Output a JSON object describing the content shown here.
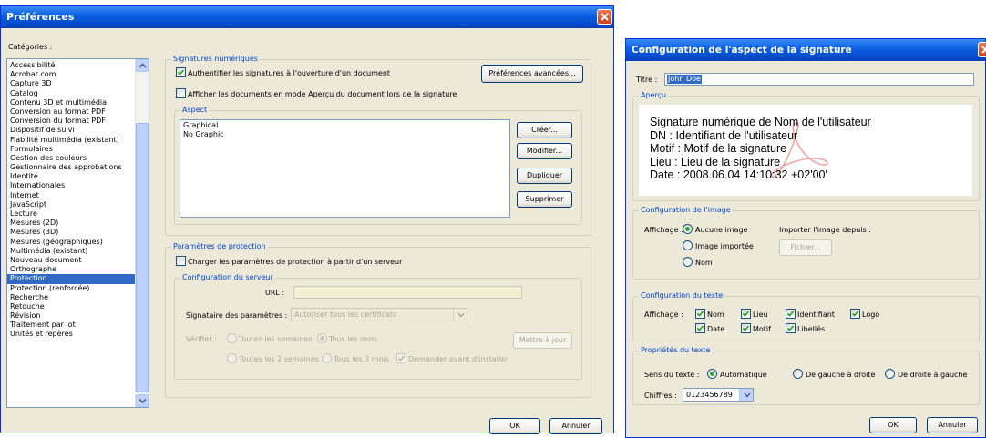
{
  "prefs": {
    "title": "Préférences",
    "categories_label": "Catégories :",
    "categories": [
      "Accessibilité",
      "Acrobat.com",
      "Capture 3D",
      "Catalog",
      "Contenu 3D et multimédia",
      "Conversion au format PDF",
      "Conversion du format PDF",
      "Dispositif de suivi",
      "Fiabilité multimédia (existant)",
      "Formulaires",
      "Gestion des couleurs",
      "Gestionnaire des approbations",
      "Identité",
      "Internationales",
      "Internet",
      "JavaScript",
      "Lecture",
      "Mesures (2D)",
      "Mesures (3D)",
      "Mesures (géographiques)",
      "Multimédia (existant)",
      "Nouveau document",
      "Orthographe",
      "Protection",
      "Protection (renforcée)",
      "Recherche",
      "Retouche",
      "Révision",
      "Traitement par lot",
      "Unités et repères"
    ],
    "selected_category": "Protection",
    "sig_group": "Signatures numériques",
    "chk_verify": "Authentifier les signatures à l'ouverture d'un document",
    "chk_preview": "Afficher les documents en mode Aperçu du document lors de la signature",
    "btn_advanced": "Préférences avancées...",
    "aspect_group": "Aspect",
    "aspects": [
      "Graphical",
      "No Graphic"
    ],
    "btn_create": "Créer...",
    "btn_modify": "Modifier...",
    "btn_duplicate": "Dupliquer",
    "btn_delete": "Supprimer",
    "security_group": "Paramètres de protection",
    "chk_load_server": "Charger les paramètres de protection à partir d'un serveur",
    "server_group": "Configuration du serveur",
    "url_label": "URL :",
    "signer_label": "Signataire des paramètres :",
    "signer_value": "Autoriser tous les certificats",
    "verify_label": "Vérifier :",
    "opt_weeks": "Toutes les semaines",
    "opt_month": "Tous les mois",
    "opt_2weeks": "Toutes les 2 semaines",
    "opt_3months": "Tous les 3 mois",
    "chk_ask": "Demander avant d'installer",
    "btn_update": "Mettre à jour",
    "ok": "OK",
    "cancel": "Annuler"
  },
  "sigcfg": {
    "title": "Configuration de l'aspect de la signature",
    "title_label": "Titre :",
    "title_value": "John Doe",
    "preview_group": "Aperçu",
    "preview_lines": [
      "Signature numérique de Nom de l'utilisateur",
      "DN : Identifiant de l'utilisateur",
      "Motif : Motif de la signature",
      "Lieu : Lieu de la signature",
      "Date : 2008.06.04 14:10:32 +02'00'"
    ],
    "image_group": "Configuration de l'image",
    "display_label": "Affichage :",
    "opt_no_image": "Aucune image",
    "opt_imported": "Image importée",
    "opt_name": "Nom",
    "import_label": "Importer l'image depuis :",
    "btn_file": "Fichier...",
    "text_group": "Configuration du texte",
    "text_display_label": "Affichage :",
    "chk_name": "Nom",
    "chk_location": "Lieu",
    "chk_identifier": "Identifiant",
    "chk_logo": "Logo",
    "chk_date": "Date",
    "chk_reason": "Motif",
    "chk_labels": "Libellés",
    "props_group": "Propriétés du texte",
    "direction_label": "Sens du texte :",
    "opt_auto": "Automatique",
    "opt_ltr": "De gauche à droite",
    "opt_rtl": "De droite à gauche",
    "digits_label": "Chiffres :",
    "digits_value": "0123456789",
    "ok": "OK",
    "cancel": "Annuler"
  }
}
